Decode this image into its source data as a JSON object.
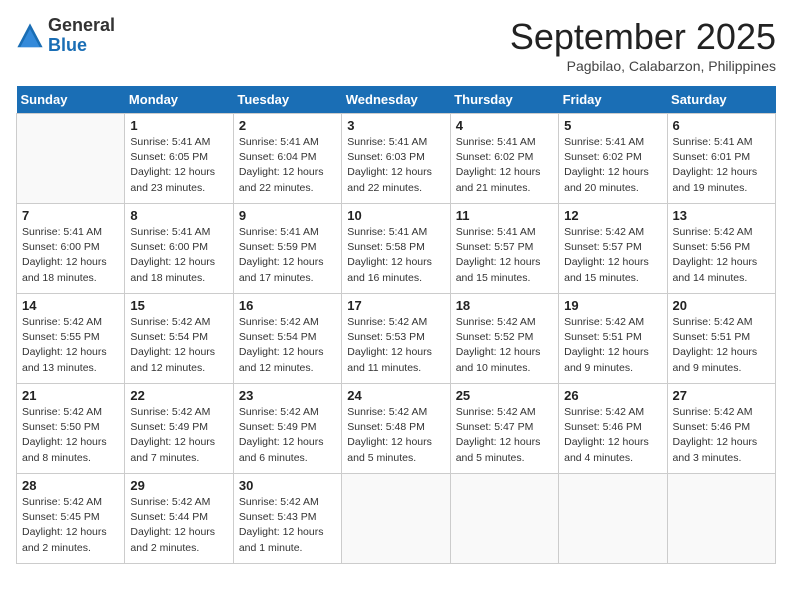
{
  "header": {
    "logo_general": "General",
    "logo_blue": "Blue",
    "month_title": "September 2025",
    "subtitle": "Pagbilao, Calabarzon, Philippines"
  },
  "days_of_week": [
    "Sunday",
    "Monday",
    "Tuesday",
    "Wednesday",
    "Thursday",
    "Friday",
    "Saturday"
  ],
  "weeks": [
    [
      {
        "day": "",
        "info": ""
      },
      {
        "day": "1",
        "info": "Sunrise: 5:41 AM\nSunset: 6:05 PM\nDaylight: 12 hours\nand 23 minutes."
      },
      {
        "day": "2",
        "info": "Sunrise: 5:41 AM\nSunset: 6:04 PM\nDaylight: 12 hours\nand 22 minutes."
      },
      {
        "day": "3",
        "info": "Sunrise: 5:41 AM\nSunset: 6:03 PM\nDaylight: 12 hours\nand 22 minutes."
      },
      {
        "day": "4",
        "info": "Sunrise: 5:41 AM\nSunset: 6:02 PM\nDaylight: 12 hours\nand 21 minutes."
      },
      {
        "day": "5",
        "info": "Sunrise: 5:41 AM\nSunset: 6:02 PM\nDaylight: 12 hours\nand 20 minutes."
      },
      {
        "day": "6",
        "info": "Sunrise: 5:41 AM\nSunset: 6:01 PM\nDaylight: 12 hours\nand 19 minutes."
      }
    ],
    [
      {
        "day": "7",
        "info": "Sunrise: 5:41 AM\nSunset: 6:00 PM\nDaylight: 12 hours\nand 18 minutes."
      },
      {
        "day": "8",
        "info": "Sunrise: 5:41 AM\nSunset: 6:00 PM\nDaylight: 12 hours\nand 18 minutes."
      },
      {
        "day": "9",
        "info": "Sunrise: 5:41 AM\nSunset: 5:59 PM\nDaylight: 12 hours\nand 17 minutes."
      },
      {
        "day": "10",
        "info": "Sunrise: 5:41 AM\nSunset: 5:58 PM\nDaylight: 12 hours\nand 16 minutes."
      },
      {
        "day": "11",
        "info": "Sunrise: 5:41 AM\nSunset: 5:57 PM\nDaylight: 12 hours\nand 15 minutes."
      },
      {
        "day": "12",
        "info": "Sunrise: 5:42 AM\nSunset: 5:57 PM\nDaylight: 12 hours\nand 15 minutes."
      },
      {
        "day": "13",
        "info": "Sunrise: 5:42 AM\nSunset: 5:56 PM\nDaylight: 12 hours\nand 14 minutes."
      }
    ],
    [
      {
        "day": "14",
        "info": "Sunrise: 5:42 AM\nSunset: 5:55 PM\nDaylight: 12 hours\nand 13 minutes."
      },
      {
        "day": "15",
        "info": "Sunrise: 5:42 AM\nSunset: 5:54 PM\nDaylight: 12 hours\nand 12 minutes."
      },
      {
        "day": "16",
        "info": "Sunrise: 5:42 AM\nSunset: 5:54 PM\nDaylight: 12 hours\nand 12 minutes."
      },
      {
        "day": "17",
        "info": "Sunrise: 5:42 AM\nSunset: 5:53 PM\nDaylight: 12 hours\nand 11 minutes."
      },
      {
        "day": "18",
        "info": "Sunrise: 5:42 AM\nSunset: 5:52 PM\nDaylight: 12 hours\nand 10 minutes."
      },
      {
        "day": "19",
        "info": "Sunrise: 5:42 AM\nSunset: 5:51 PM\nDaylight: 12 hours\nand 9 minutes."
      },
      {
        "day": "20",
        "info": "Sunrise: 5:42 AM\nSunset: 5:51 PM\nDaylight: 12 hours\nand 9 minutes."
      }
    ],
    [
      {
        "day": "21",
        "info": "Sunrise: 5:42 AM\nSunset: 5:50 PM\nDaylight: 12 hours\nand 8 minutes."
      },
      {
        "day": "22",
        "info": "Sunrise: 5:42 AM\nSunset: 5:49 PM\nDaylight: 12 hours\nand 7 minutes."
      },
      {
        "day": "23",
        "info": "Sunrise: 5:42 AM\nSunset: 5:49 PM\nDaylight: 12 hours\nand 6 minutes."
      },
      {
        "day": "24",
        "info": "Sunrise: 5:42 AM\nSunset: 5:48 PM\nDaylight: 12 hours\nand 5 minutes."
      },
      {
        "day": "25",
        "info": "Sunrise: 5:42 AM\nSunset: 5:47 PM\nDaylight: 12 hours\nand 5 minutes."
      },
      {
        "day": "26",
        "info": "Sunrise: 5:42 AM\nSunset: 5:46 PM\nDaylight: 12 hours\nand 4 minutes."
      },
      {
        "day": "27",
        "info": "Sunrise: 5:42 AM\nSunset: 5:46 PM\nDaylight: 12 hours\nand 3 minutes."
      }
    ],
    [
      {
        "day": "28",
        "info": "Sunrise: 5:42 AM\nSunset: 5:45 PM\nDaylight: 12 hours\nand 2 minutes."
      },
      {
        "day": "29",
        "info": "Sunrise: 5:42 AM\nSunset: 5:44 PM\nDaylight: 12 hours\nand 2 minutes."
      },
      {
        "day": "30",
        "info": "Sunrise: 5:42 AM\nSunset: 5:43 PM\nDaylight: 12 hours\nand 1 minute."
      },
      {
        "day": "",
        "info": ""
      },
      {
        "day": "",
        "info": ""
      },
      {
        "day": "",
        "info": ""
      },
      {
        "day": "",
        "info": ""
      }
    ]
  ]
}
